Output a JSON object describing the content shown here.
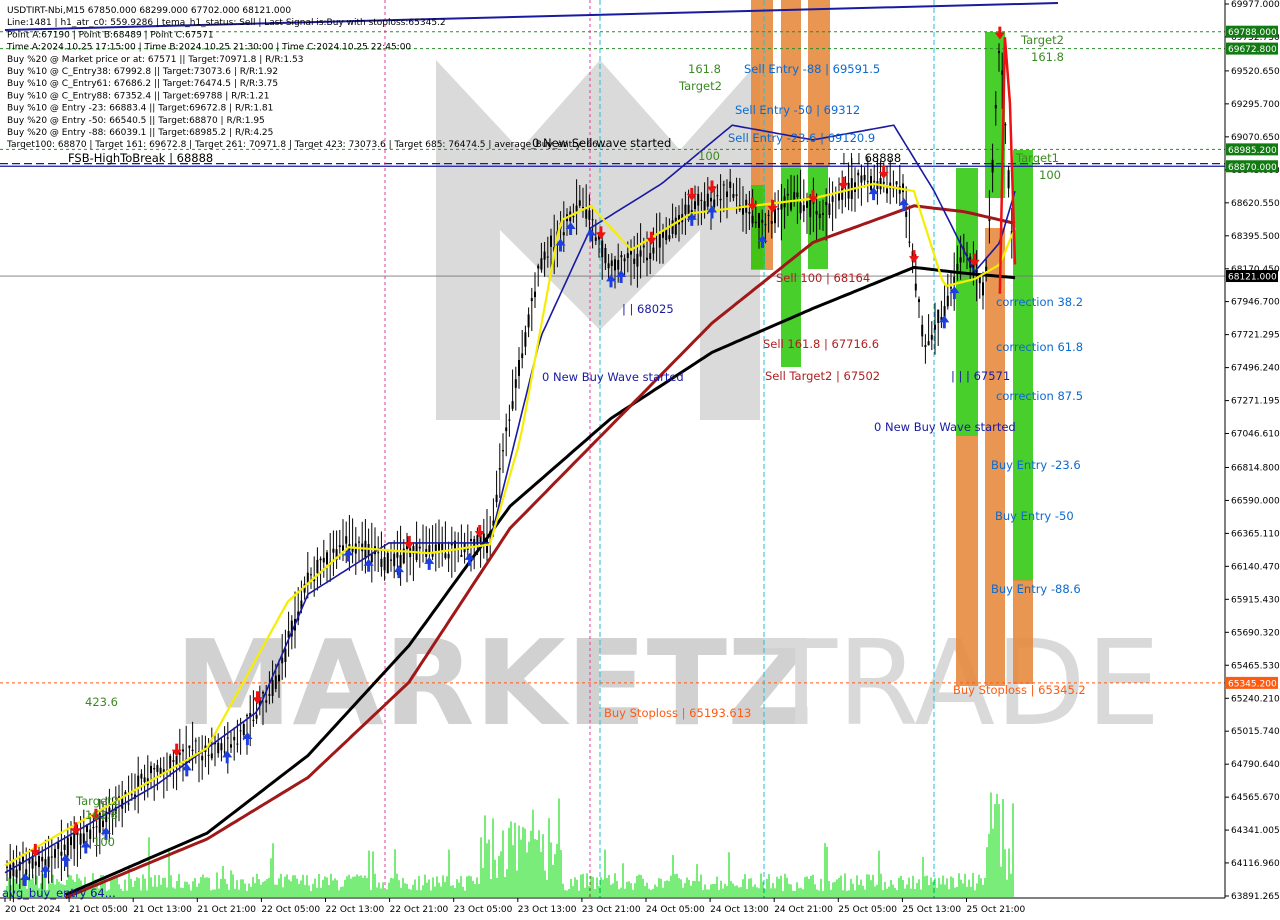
{
  "header": {
    "info_lines": [
      "USDTIRT-Nbi,M15  67850.000 68299.000 67702.000 68121.000",
      "Line:1481 | h1_atr_c0: 559.9286 | tema_h1_status: Sell | Last Signal is:Buy with stoploss:65345.2",
      "Point A:67190 | Point B:68489 | Point C:67571",
      "Time A:2024.10.25 17:15:00 | Time B:2024.10.25 21:30:00 | Time C:2024.10.25 22:45:00",
      "Buy %20 @ Market price or at: 67571 || Target:70971.8 | R/R:1.53",
      "Buy %10 @ C_Entry38: 67992.8 || Target:73073.6 | R/R:1.92",
      "Buy %10 @ C_Entry61: 67686.2 || Target:76474.5 | R/R:3.75",
      "Buy %10 @ C_Entry88: 67352.4 || Target:69788 | R/R:1.21",
      "Buy %10 @ Entry -23: 66883.4 || Target:69672.8 | R/R:1.81",
      "Buy %20 @ Entry -50: 66540.5 || Target:68870 | R/R:1.95",
      "Buy %20 @ Entry -88: 66039.1 || Target:68985.2 | R/R:4.25",
      "Target100: 68870 | Target 161: 69672.8 | Target 261: 70971.8 | Target 423: 73073.6 | Target 685: 76474.5 | average_Buy_entry: 66..."
    ]
  },
  "watermark": {
    "left": "MARKETZ",
    "right": "TRADE"
  },
  "colors": {
    "sell": "#ee1111",
    "buy": "#1e3fe0",
    "green_zone": "#2fc80f",
    "orange_zone": "#e5883a",
    "black_ma": "#000000",
    "red_ma": "#a01818",
    "blue_ma": "#1a1aa0",
    "yellow_ma": "#f5ee00",
    "volume": "#22e022",
    "candle": "#000000",
    "target_green": "#3b8a22",
    "sell_red": "#b02020",
    "stoploss": "#ff5a10",
    "price_tag": "#000000",
    "dark_green_tag": "#127a12"
  },
  "annotations": [
    {
      "id": "fsb",
      "text": "FSB-HighToBreak | 68888",
      "color": "#000000"
    },
    {
      "id": "sellwave",
      "text": "0 New Sell wave started",
      "color": "#000000"
    },
    {
      "id": "fib1618top",
      "text": "161.8",
      "color": "#3b8a22"
    },
    {
      "id": "target2top",
      "text": "Target2",
      "color": "#3b8a22"
    },
    {
      "id": "sell88",
      "text": "Sell Entry -88 | 69591.5",
      "color": "#0c6ad0"
    },
    {
      "id": "sell50",
      "text": "Sell Entry -50 | 69312",
      "color": "#0c6ad0"
    },
    {
      "id": "sell236",
      "text": "Sell Entry -23.6 | 69120.9",
      "color": "#0c6ad0"
    },
    {
      "id": "fib100top",
      "text": "100",
      "color": "#3b8a22"
    },
    {
      "id": "pointb",
      "text": "| | | 68888",
      "color": "#000000"
    },
    {
      "id": "l68025",
      "text": "| | 68025",
      "color": "#1a1aa0"
    },
    {
      "id": "sell100",
      "text": "Sell 100 | 68164",
      "color": "#b02020"
    },
    {
      "id": "sell1618",
      "text": "Sell 161.8 | 67716.6",
      "color": "#b02020"
    },
    {
      "id": "selltarget2",
      "text": "Sell Target2 | 67502",
      "color": "#b02020"
    },
    {
      "id": "buywave1",
      "text": "0 New Buy Wave started",
      "color": "#1a1aa0"
    },
    {
      "id": "buywave2",
      "text": "0 New Buy Wave started",
      "color": "#1a1aa0"
    },
    {
      "id": "l67571",
      "text": "| | | 67571",
      "color": "#1a1aa0"
    },
    {
      "id": "target2right",
      "text": "Target2",
      "color": "#3b8a22"
    },
    {
      "id": "fib1618right",
      "text": "161.8",
      "color": "#3b8a22"
    },
    {
      "id": "target1",
      "text": "Target1",
      "color": "#3b8a22"
    },
    {
      "id": "fib100right",
      "text": "100",
      "color": "#3b8a22"
    },
    {
      "id": "corr382",
      "text": "correction 38.2",
      "color": "#0c6ad0"
    },
    {
      "id": "corr618",
      "text": "correction 61.8",
      "color": "#0c6ad0"
    },
    {
      "id": "corr875",
      "text": "correction 87.5",
      "color": "#0c6ad0"
    },
    {
      "id": "buy236",
      "text": "Buy Entry -23.6",
      "color": "#0c6ad0"
    },
    {
      "id": "buy50",
      "text": "Buy Entry -50",
      "color": "#0c6ad0"
    },
    {
      "id": "buy886",
      "text": "Buy Entry -88.6",
      "color": "#0c6ad0"
    },
    {
      "id": "buystoploss",
      "text": "Buy Stoploss | 65345.2",
      "color": "#ff5a10"
    },
    {
      "id": "stoploss2",
      "text": "Buy Stoploss | 65193.613",
      "color": "#ff5a10"
    },
    {
      "id": "fib4236",
      "text": "423.6",
      "color": "#3b8a22"
    },
    {
      "id": "target2left",
      "text": "Target2",
      "color": "#3b8a22"
    },
    {
      "id": "fib1638left",
      "text": "163.8",
      "color": "#3b8a22"
    },
    {
      "id": "fib100left",
      "text": "100",
      "color": "#3b8a22"
    },
    {
      "id": "avgbuy",
      "text": "avg_buy_entry 64...",
      "color": "#1a1aa0"
    }
  ],
  "chart_data": {
    "type": "line",
    "symbol": "USDTIRT-Nbi",
    "timeframe": "M15",
    "ohlc_last": {
      "open": 67850.0,
      "high": 68299.0,
      "low": 67702.0,
      "close": 68121.0
    },
    "y_ticks": [
      "69977.000",
      "69752.730",
      "69520.650",
      "69295.700",
      "69070.650",
      "68845.600",
      "68620.550",
      "68395.500",
      "68170.450",
      "67946.700",
      "67721.295",
      "67496.240",
      "67271.195",
      "67046.610",
      "66814.800",
      "66590.000",
      "66365.110",
      "66140.470",
      "65915.430",
      "65690.320",
      "65465.530",
      "65240.210",
      "65015.740",
      "64790.640",
      "64565.670",
      "64341.005",
      "64116.960",
      "63891.265"
    ],
    "ylim": [
      63891.265,
      69977.0
    ],
    "x_ticks": [
      "20 Oct 2024",
      "21 Oct 05:00",
      "21 Oct 13:00",
      "21 Oct 21:00",
      "22 Oct 05:00",
      "22 Oct 13:00",
      "22 Oct 21:00",
      "23 Oct 05:00",
      "23 Oct 13:00",
      "23 Oct 21:00",
      "24 Oct 05:00",
      "24 Oct 13:00",
      "24 Oct 21:00",
      "25 Oct 05:00",
      "25 Oct 13:00",
      "25 Oct 21:00"
    ],
    "price_tags": [
      {
        "label": "69788.000",
        "value": 69788.0,
        "color": "#127a12"
      },
      {
        "label": "69672.800",
        "value": 69672.8,
        "color": "#127a12"
      },
      {
        "label": "68985.200",
        "value": 68985.2,
        "color": "#127a12"
      },
      {
        "label": "68870.000",
        "value": 68870.0,
        "color": "#127a12"
      },
      {
        "label": "68121.000",
        "value": 68121.0,
        "color": "#000000"
      },
      {
        "label": "65345.200",
        "value": 65345.2,
        "color": "#ff5a10"
      }
    ],
    "close_series": [
      {
        "x": 0.0,
        "y": 64040
      },
      {
        "x": 0.05,
        "y": 64180
      },
      {
        "x": 0.1,
        "y": 64410
      },
      {
        "x": 0.14,
        "y": 64700
      },
      {
        "x": 0.19,
        "y": 64880
      },
      {
        "x": 0.23,
        "y": 64950
      },
      {
        "x": 0.27,
        "y": 65380
      },
      {
        "x": 0.3,
        "y": 66050
      },
      {
        "x": 0.34,
        "y": 66310
      },
      {
        "x": 0.38,
        "y": 66170
      },
      {
        "x": 0.41,
        "y": 66250
      },
      {
        "x": 0.45,
        "y": 66260
      },
      {
        "x": 0.48,
        "y": 66320
      },
      {
        "x": 0.5,
        "y": 67200
      },
      {
        "x": 0.53,
        "y": 68200
      },
      {
        "x": 0.57,
        "y": 68650
      },
      {
        "x": 0.6,
        "y": 68180
      },
      {
        "x": 0.64,
        "y": 68300
      },
      {
        "x": 0.68,
        "y": 68600
      },
      {
        "x": 0.72,
        "y": 68700
      },
      {
        "x": 0.75,
        "y": 68450
      },
      {
        "x": 0.78,
        "y": 68650
      },
      {
        "x": 0.81,
        "y": 68550
      },
      {
        "x": 0.85,
        "y": 68800
      },
      {
        "x": 0.89,
        "y": 68700
      },
      {
        "x": 0.91,
        "y": 67650
      },
      {
        "x": 0.93,
        "y": 67900
      },
      {
        "x": 0.95,
        "y": 68300
      },
      {
        "x": 0.97,
        "y": 68000
      },
      {
        "x": 0.985,
        "y": 69700
      },
      {
        "x": 1.0,
        "y": 68121
      }
    ],
    "series": [
      {
        "name": "black",
        "values": [
          {
            "x": 0.06,
            "y": 63900
          },
          {
            "x": 0.2,
            "y": 64320
          },
          {
            "x": 0.3,
            "y": 64850
          },
          {
            "x": 0.4,
            "y": 65600
          },
          {
            "x": 0.5,
            "y": 66550
          },
          {
            "x": 0.6,
            "y": 67150
          },
          {
            "x": 0.7,
            "y": 67600
          },
          {
            "x": 0.8,
            "y": 67900
          },
          {
            "x": 0.9,
            "y": 68180
          },
          {
            "x": 0.95,
            "y": 68140
          },
          {
            "x": 1.0,
            "y": 68110
          }
        ]
      },
      {
        "name": "darkred",
        "values": [
          {
            "x": 0.06,
            "y": 63880
          },
          {
            "x": 0.2,
            "y": 64280
          },
          {
            "x": 0.3,
            "y": 64700
          },
          {
            "x": 0.4,
            "y": 65350
          },
          {
            "x": 0.5,
            "y": 66400
          },
          {
            "x": 0.6,
            "y": 67100
          },
          {
            "x": 0.7,
            "y": 67800
          },
          {
            "x": 0.8,
            "y": 68350
          },
          {
            "x": 0.9,
            "y": 68600
          },
          {
            "x": 0.95,
            "y": 68560
          },
          {
            "x": 1.0,
            "y": 68480
          }
        ]
      },
      {
        "name": "blue",
        "values": [
          {
            "x": 0.0,
            "y": 64050
          },
          {
            "x": 0.15,
            "y": 64650
          },
          {
            "x": 0.25,
            "y": 65150
          },
          {
            "x": 0.3,
            "y": 65950
          },
          {
            "x": 0.38,
            "y": 66300
          },
          {
            "x": 0.48,
            "y": 66300
          },
          {
            "x": 0.53,
            "y": 67700
          },
          {
            "x": 0.58,
            "y": 68450
          },
          {
            "x": 0.65,
            "y": 68750
          },
          {
            "x": 0.72,
            "y": 69150
          },
          {
            "x": 0.8,
            "y": 69050
          },
          {
            "x": 0.88,
            "y": 69150
          },
          {
            "x": 0.92,
            "y": 68700
          },
          {
            "x": 0.96,
            "y": 68150
          },
          {
            "x": 0.985,
            "y": 68350
          },
          {
            "x": 1.0,
            "y": 68700
          }
        ]
      },
      {
        "name": "yellow",
        "values": [
          {
            "x": 0.0,
            "y": 64100
          },
          {
            "x": 0.1,
            "y": 64500
          },
          {
            "x": 0.2,
            "y": 64900
          },
          {
            "x": 0.28,
            "y": 65900
          },
          {
            "x": 0.34,
            "y": 66270
          },
          {
            "x": 0.42,
            "y": 66230
          },
          {
            "x": 0.48,
            "y": 66290
          },
          {
            "x": 0.51,
            "y": 67000
          },
          {
            "x": 0.55,
            "y": 68500
          },
          {
            "x": 0.58,
            "y": 68600
          },
          {
            "x": 0.62,
            "y": 68300
          },
          {
            "x": 0.68,
            "y": 68550
          },
          {
            "x": 0.74,
            "y": 68600
          },
          {
            "x": 0.8,
            "y": 68650
          },
          {
            "x": 0.86,
            "y": 68750
          },
          {
            "x": 0.9,
            "y": 68700
          },
          {
            "x": 0.93,
            "y": 68050
          },
          {
            "x": 0.96,
            "y": 68100
          },
          {
            "x": 0.985,
            "y": 68200
          },
          {
            "x": 1.0,
            "y": 68450
          }
        ]
      }
    ]
  }
}
